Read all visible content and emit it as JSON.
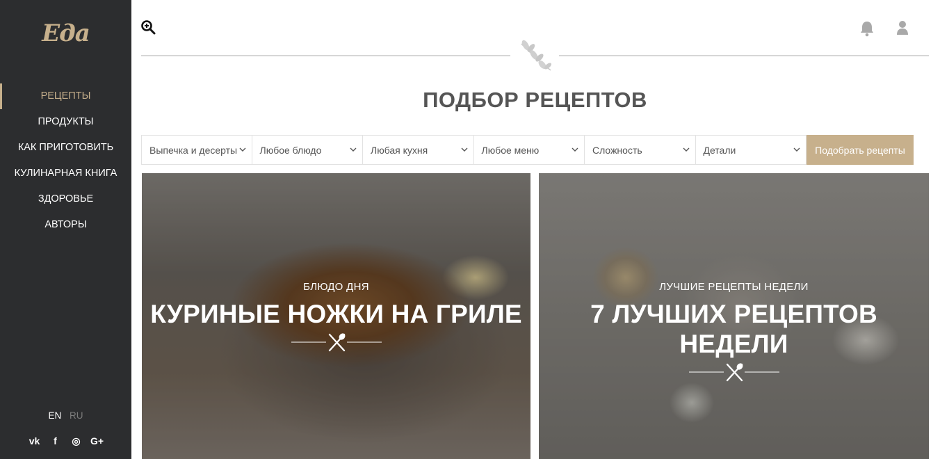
{
  "brand": {
    "logo_text": "Eдa",
    "accent_color": "#c7b08c",
    "sidebar_bg": "#2c2d2f"
  },
  "sidebar": {
    "items": [
      {
        "label": "РЕЦЕПТЫ",
        "active": true
      },
      {
        "label": "ПРОДУКТЫ",
        "active": false
      },
      {
        "label": "КАК ПРИГОТОВИТЬ",
        "active": false
      },
      {
        "label": "КУЛИНАРНАЯ КНИГА",
        "active": false
      },
      {
        "label": "ЗДОРОВЬЕ",
        "active": false
      },
      {
        "label": "АВТОРЫ",
        "active": false
      }
    ],
    "languages": [
      {
        "label": "EN",
        "active": true
      },
      {
        "label": "RU",
        "active": false
      }
    ],
    "social": [
      {
        "icon": "vk-icon",
        "glyph": "vk"
      },
      {
        "icon": "facebook-icon",
        "glyph": "f"
      },
      {
        "icon": "instagram-icon",
        "glyph": "◎"
      },
      {
        "icon": "google-plus-icon",
        "glyph": "G+"
      }
    ]
  },
  "header": {
    "icons": [
      "zoom-in-icon",
      "bell-icon",
      "user-icon"
    ],
    "ornament": "olive-branch-icon"
  },
  "main": {
    "title": "ПОДБОР РЕЦЕПТОВ",
    "filters": [
      {
        "label": "Выпечка и десерты"
      },
      {
        "label": "Любое блюдо"
      },
      {
        "label": "Любая кухня"
      },
      {
        "label": "Любое меню"
      },
      {
        "label": "Сложность"
      },
      {
        "label": "Детали"
      }
    ],
    "submit_label": "Подобрать рецепты",
    "cards": [
      {
        "kicker": "БЛЮДО ДНЯ",
        "headline": "КУРИНЫЕ НОЖКИ НА ГРИЛЕ"
      },
      {
        "kicker": "ЛУЧШИЕ РЕЦЕПТЫ НЕДЕЛИ",
        "headline_line1": "7 ЛУЧШИХ РЕЦЕПТОВ",
        "headline_line2": "НЕДЕЛИ"
      }
    ]
  }
}
